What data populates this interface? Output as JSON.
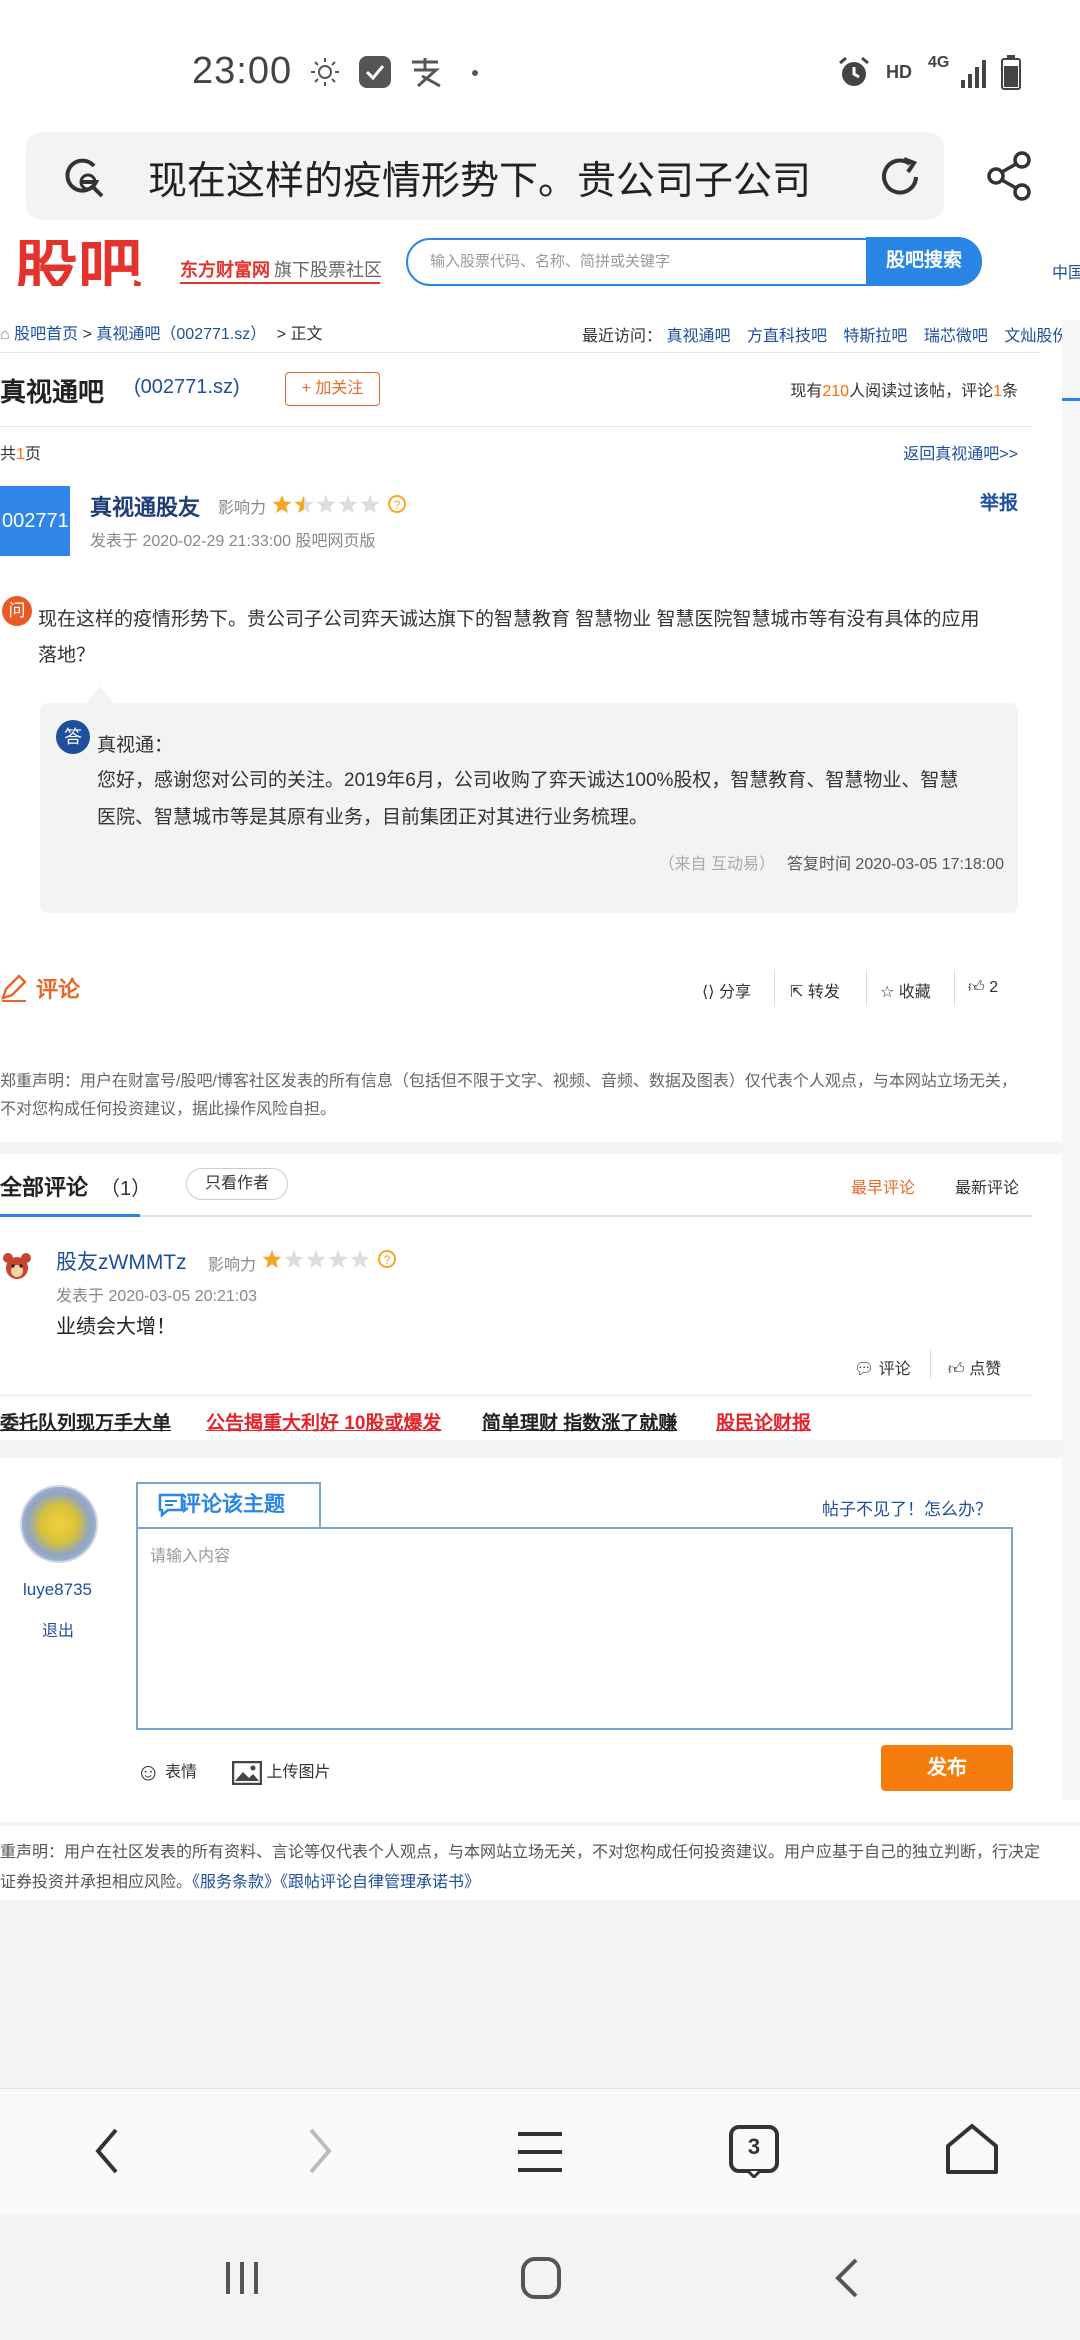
{
  "status_bar": {
    "time": "23:00",
    "hd_label": "HD",
    "network_label": "4G"
  },
  "browser": {
    "url_text": "现在这样的疫情形势下。贵公司子公司"
  },
  "site_header": {
    "logo_text": "股吧",
    "logo_sub_left": "东方财富网",
    "logo_sub_right": "旗下股票社区",
    "search_placeholder": "输入股票代码、名称、简拼或关键字",
    "search_button": "股吧搜索",
    "right_cut_text": "中国"
  },
  "breadcrumb": {
    "home": "股吧首页",
    "sep1": ">",
    "bar": "真视通吧（002771.sz）",
    "sep2": "> 正文",
    "recent_label": "最近访问：",
    "recent_items": [
      "真视通吧",
      "方直科技吧",
      "特斯拉吧",
      "瑞芯微吧",
      "文灿股份吧"
    ]
  },
  "post_header": {
    "bar_title": "真视通吧",
    "code": "(002771.sz)",
    "follow_button": "+ 加关注",
    "read_prefix": "现有",
    "read_count": "210",
    "read_suffix": "人阅读过该帖，评论",
    "comment_count": "1",
    "comment_suffix": "条",
    "pages_prefix": "共",
    "pages_count": "1",
    "pages_suffix": "页",
    "back_link": "返回真视通吧>>"
  },
  "post": {
    "avatar_text": "002771",
    "author": "真视通股友",
    "influence_label": "影响力",
    "influence_stars": 1.5,
    "publish_time": "发表于 2020-02-29 21:33:00 股吧网页版",
    "report": "举报",
    "q_icon": "问",
    "question": "现在这样的疫情形势下。贵公司子公司弈天诚达旗下的智慧教育 智慧物业 智慧医院智慧城市等有没有具体的应用落地？",
    "a_icon": "答",
    "answer_name": "真视通：",
    "answer": "您好，感谢您对公司的关注。2019年6月，公司收购了弈天诚达100%股权，智慧教育、智慧物业、智慧医院、智慧城市等是其原有业务，目前集团正对其进行业务梳理。",
    "answer_source": "（来自 互动易）",
    "answer_time": "答复时间 2020-03-05 17:18:00"
  },
  "actions": {
    "comment": "评论",
    "share": "分享",
    "forward": "转发",
    "favorite": "收藏",
    "like_count": "2"
  },
  "disclaimer": "郑重声明：用户在财富号/股吧/博客社区发表的所有信息（包括但不限于文字、视频、音频、数据及图表）仅代表个人观点，与本网站立场无关，不对您构成任何投资建议，据此操作风险自担。",
  "comments_section": {
    "title": "全部评论",
    "count": "（1）",
    "only_author": "只看作者",
    "sort_earliest": "最早评论",
    "sort_newest": "最新评论",
    "items": [
      {
        "author": "股友zWMMTz",
        "influence_label": "影响力",
        "stars": 1,
        "time": "发表于 2020-03-05 20:21:03",
        "text": "业绩会大增！",
        "reply_label": "评论",
        "like_label": "点赞"
      }
    ]
  },
  "promo_links": [
    {
      "text": "委托队列现万手大单",
      "color": "dark"
    },
    {
      "text": "公告揭重大利好 10股或爆发",
      "color": "red"
    },
    {
      "text": "简单理财 指数涨了就赚",
      "color": "dark"
    },
    {
      "text": "股民论财报",
      "color": "red"
    }
  ],
  "reply_box": {
    "username": "luye8735",
    "logout": "退出",
    "tab_title": "评论该主题",
    "post_missing": "帖子不见了！怎么办？",
    "placeholder": "请输入内容",
    "emoji_label": "表情",
    "upload_label": "上传图片",
    "publish_button": "发布"
  },
  "footer": {
    "disclaimer_start": "重声明：用户在社区发表的所有资料、言论等仅代表个人观点，与本网站立场无关，不对您构成任何投资建议。用户应基于自己的独立判断，行决定证券投资并承担相应风险。",
    "terms_link": "《服务条款》",
    "pledge_link": "《跟帖评论自律管理承诺书》"
  },
  "browser_bottom": {
    "tab_count": "3"
  }
}
